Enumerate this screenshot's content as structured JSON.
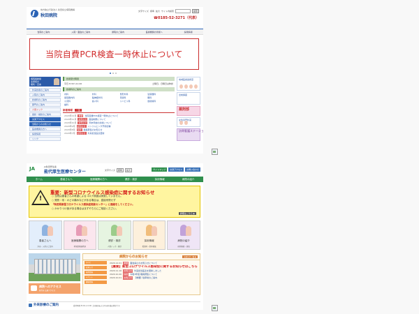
{
  "shot1": {
    "header": {
      "subtitle": "地方独立行政法人 秋田県立病院機構",
      "site_name": "秋田病院",
      "tools": [
        "文字サイズ",
        "標準",
        "拡大",
        "サイト内検索"
      ],
      "search_button": "検索",
      "phone": "☎0185-52-3271（代表）"
    },
    "nav": [
      "当院のご案内",
      "入院・面会のご案内",
      "通院のご案内",
      "医療機関の皆様へ",
      "採用情報"
    ],
    "banner_text": "当院自費PCR検査一時休止について",
    "left_banner": [
      "病院長挨拶",
      "患者様の",
      "権利・宣言"
    ],
    "left_links": [
      {
        "label": "外来診療のご案内",
        "style": "normal"
      },
      {
        "label": "入院のご案内",
        "style": "normal"
      },
      {
        "label": "診療科のご案内",
        "style": "normal"
      },
      {
        "label": "部門のご案内",
        "style": "normal"
      },
      {
        "label": "人間ドック",
        "style": "red"
      },
      {
        "label": "健診・検診のご案内",
        "style": "normal"
      },
      {
        "label": "交通アクセス",
        "style": "blue"
      },
      {
        "label": "当院からのお知らせ",
        "style": "blue"
      },
      {
        "label": "医療機関の方へ",
        "style": "normal"
      },
      {
        "label": "採用情報",
        "style": "normal"
      },
      {
        "label": "リンク",
        "style": "normal"
      }
    ],
    "hours_title": "診療受付時間",
    "hours_row": [
      "平日 8:30～11:00",
      "土曜日、日曜日は休診"
    ],
    "dept_title": "診療科のご案内",
    "depts": [
      "内科",
      "外科",
      "整形外科",
      "泌尿器科",
      "循環器内科",
      "脳神経外科",
      "皮膚科",
      "眼科",
      "小児科",
      "婦人科",
      "リハビリ科",
      "放射線科",
      "歯科"
    ],
    "news_title": "新着情報",
    "news_tab": "一覧",
    "news": [
      {
        "date": "2020年12月",
        "tag": "重要",
        "title": "当院自費PCR検査一時休止について"
      },
      {
        "date": "2020年11月",
        "tag": "お知らせ",
        "title": "面会制限について"
      },
      {
        "date": "2020年10月",
        "tag": "お知らせ",
        "title": "年末年始の診療について"
      },
      {
        "date": "2020年9月",
        "tag": "お知らせ",
        "title": "インフルエンザ予防接種"
      },
      {
        "date": "2020年8月",
        "tag": "採用",
        "title": "職員募集のお知らせ"
      },
      {
        "date": "2020年7月",
        "tag": "お知らせ",
        "title": "外来担当医表更新"
      }
    ],
    "right_boxes": [
      {
        "label": "地域医療連携室",
        "style": "normal"
      },
      {
        "label": "出前講座",
        "style": "normal"
      },
      {
        "label": "薬剤部",
        "style": "pink"
      },
      {
        "label": "女性専門外来",
        "style": "normal"
      },
      {
        "label": "訪問看護ステーション",
        "style": "purple"
      }
    ]
  },
  "shot2": {
    "header": {
      "ja_logo": "JA",
      "subtitle": "JA秋田厚生連",
      "site_name": "能代厚生医療センター",
      "font_label": "文字サイズ",
      "font_buttons": [
        "標準",
        "拡大"
      ],
      "tools": [
        "サイトマップ",
        "交通アクセス",
        "お問い合わせ"
      ]
    },
    "nav": [
      "ホーム",
      "患者さんへ",
      "医療機関の方へ",
      "健診・検診",
      "採用情報",
      "病院の紹介"
    ],
    "alert": {
      "title": "重要：新型コロナウイルス感染症に関するお知らせ",
      "lines": [
        "○ 当院は患者さんの希望によるコロナ検査は実施していません。",
        "○ 発熱・咳・のどの痛みなどがある場合は、直接来院せず",
        "「秋田県新型コロナウイルス感染症相談センター」に連絡をしてください。",
        "○ かかりつけ医がある場合はまずそちらにご相談ください。"
      ],
      "details": "詳細はこちら ▶"
    },
    "categories": [
      {
        "label": "患者さんへ",
        "caption": "外来・入院のご案内",
        "tone": "blue"
      },
      {
        "label": "医療機関の方へ",
        "caption": "地域医療連携室",
        "tone": "pink"
      },
      {
        "label": "健診・検診",
        "caption": "人間ドック・健診",
        "tone": "green"
      },
      {
        "label": "採用情報",
        "caption": "看護師・医師募集",
        "tone": "orange"
      },
      {
        "label": "病院の紹介",
        "caption": "病院概要・理念",
        "tone": "purple"
      }
    ],
    "access": {
      "title": "病院へのアクセス",
      "caption": "能代市 交通アクセス"
    },
    "news": {
      "title": "病院からのお知らせ",
      "list_button": "お知らせ一覧 ▶",
      "tabs": [
        "すべて",
        "お知らせ",
        "採用情報",
        "イベント",
        "健康情報"
      ],
      "items": [
        {
          "date": "2020.12.01",
          "tag": "重要",
          "title": "面会禁止のお知らせについて",
          "big": false
        },
        {
          "date": "2020.11.27",
          "tag": "重要",
          "title": "【重要】新型コロナウイルス感染症に関するお知らせはこちら",
          "big": true
        },
        {
          "date": "2020.11.10",
          "tag": "お知らせ",
          "title": "外来担当医表を更新しました",
          "big": false
        },
        {
          "date": "2020.10.20",
          "tag": "採用",
          "title": "令和3年度 職員募集について",
          "big": false
        },
        {
          "date": "2020.10.01",
          "tag": "お知らせ",
          "title": "【重要】駐車場のご案内",
          "big": false
        }
      ]
    },
    "footer": {
      "title": "外来診療のご案内",
      "caption": "受付時間 8:00～11:00 土日祝日および年末年始は休診です"
    }
  }
}
